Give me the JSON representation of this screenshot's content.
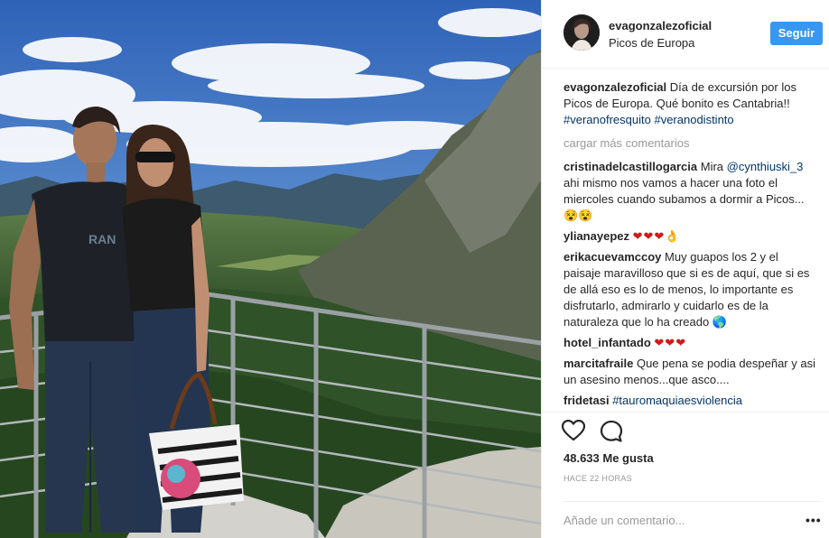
{
  "header": {
    "username": "evagonzalezoficial",
    "location": "Picos de Europa",
    "follow_label": "Seguir"
  },
  "caption": {
    "username": "evagonzalezoficial",
    "text": "Día de excursión por los Picos de Europa. Qué bonito es Cantabria!!",
    "hashtags": [
      "#veranofresquito",
      "#veranodistinto"
    ]
  },
  "load_more_label": "cargar más comentarios",
  "comments": [
    {
      "username": "cristinadelcastillogarcia",
      "text_before": "Mira",
      "mention": "@cynthiuski_3",
      "text_after": "ahi mismo nos vamos a hacer una foto el miercoles cuando subamos a dormir a Picos...",
      "emoji": "😵😵"
    },
    {
      "username": "ylianayepez",
      "emoji": "❤❤❤👌"
    },
    {
      "username": "erikacuevamccoy",
      "text": "Muy guapos los 2 y el paisaje maravilloso que si es de aquí, que si es de allá eso es lo de menos, lo importante es disfrutarlo, admirarlo y cuidarlo es de la naturaleza que lo ha creado",
      "emoji": "🌎"
    },
    {
      "username": "hotel_infantado",
      "emoji": "❤❤❤"
    },
    {
      "username": "marcitafraile",
      "text": "Que pena se podia despeñar y asi un asesino menos...que asco...."
    },
    {
      "username": "fridetasi",
      "tag": "#tauromaquiaesviolencia"
    }
  ],
  "actions": {
    "like_icon": "heart-outline-icon",
    "comment_icon": "speech-bubble-icon",
    "likes_text": "48.633 Me gusta",
    "time_text": "HACE 22 HORAS"
  },
  "add_comment": {
    "placeholder": "Añade un comentario...",
    "more_label": "•••"
  },
  "colors": {
    "follow_blue": "#3897f0",
    "link_blue": "#003569",
    "heart_red": "#d01a1a",
    "muted": "#999999"
  }
}
